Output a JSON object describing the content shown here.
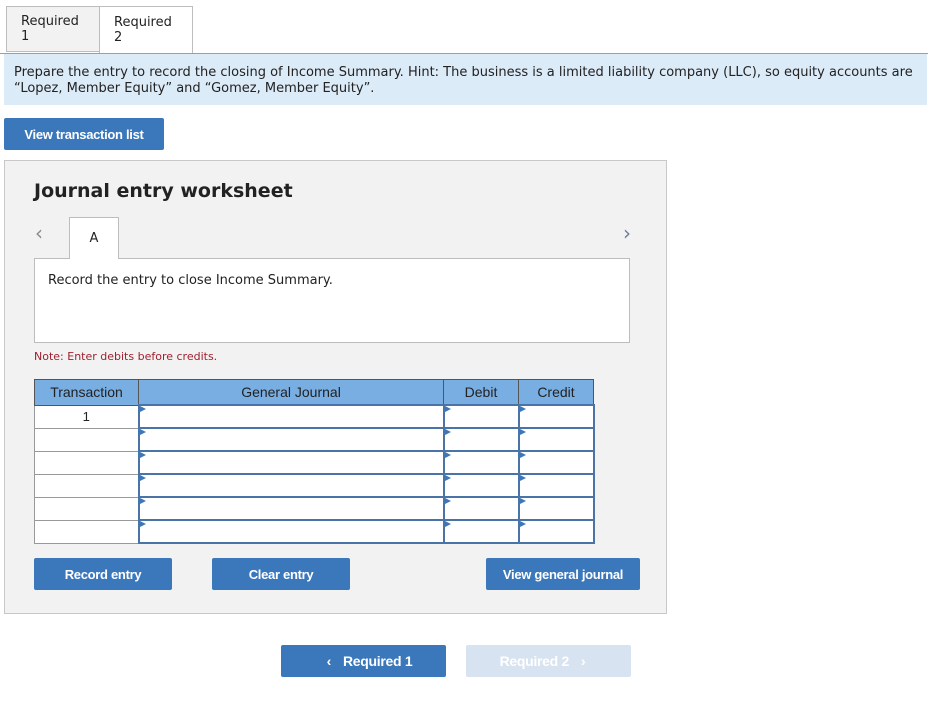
{
  "tabs": [
    {
      "label": "Required 1",
      "active": false
    },
    {
      "label": "Required 2",
      "active": true
    }
  ],
  "instruction": "Prepare the entry to record the closing of Income Summary. Hint: The business is a limited liability company (LLC), so equity accounts are “Lopez, Member Equity” and “Gomez, Member Equity”.",
  "buttons": {
    "view_transaction_list": "View transaction list",
    "record_entry": "Record entry",
    "clear_entry": "Clear entry",
    "view_general_journal": "View general journal"
  },
  "worksheet": {
    "title": "Journal entry worksheet",
    "prev_icon": "chevron-left-icon",
    "next_icon": "chevron-right-icon",
    "entry_tab": "A",
    "entry_description": "Record the entry to close Income Summary.",
    "note": "Note: Enter debits before credits."
  },
  "journal": {
    "headers": [
      "Transaction",
      "General Journal",
      "Debit",
      "Credit"
    ],
    "rows": [
      {
        "transaction": "1",
        "account": "",
        "debit": "",
        "credit": ""
      },
      {
        "transaction": "",
        "account": "",
        "debit": "",
        "credit": ""
      },
      {
        "transaction": "",
        "account": "",
        "debit": "",
        "credit": ""
      },
      {
        "transaction": "",
        "account": "",
        "debit": "",
        "credit": ""
      },
      {
        "transaction": "",
        "account": "",
        "debit": "",
        "credit": ""
      },
      {
        "transaction": "",
        "account": "",
        "debit": "",
        "credit": ""
      }
    ]
  },
  "bottom_nav": {
    "prev_label": "Required 1",
    "next_label": "Required 2",
    "prev_chevron": "‹",
    "next_chevron": "›",
    "next_disabled": true
  },
  "colors": {
    "primary_button": "#3a77bb",
    "instruction_bg": "#dcebf8",
    "table_header": "#79aee3",
    "note_text": "#a0202f",
    "disabled_button": "#d8e3f1"
  }
}
